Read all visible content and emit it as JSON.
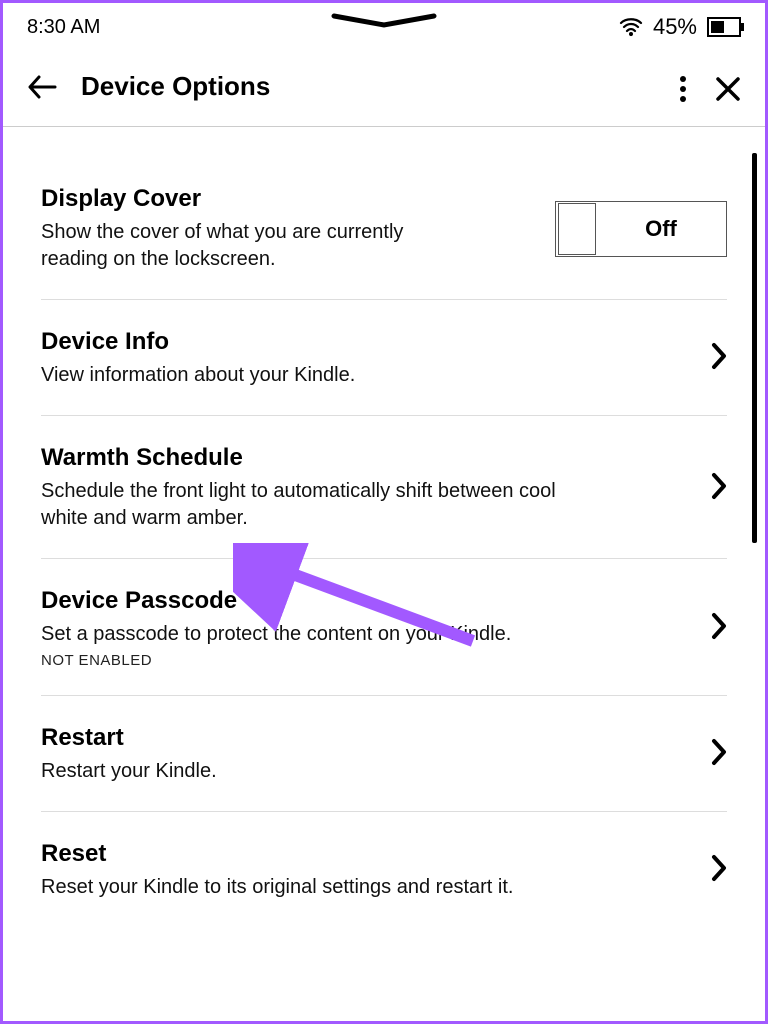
{
  "statusbar": {
    "time": "8:30 AM",
    "battery": "45%"
  },
  "header": {
    "title": "Device Options"
  },
  "items": [
    {
      "title": "Display Cover",
      "sub": "Show the cover of what you are currently reading on the lockscreen.",
      "toggle_state": "Off"
    },
    {
      "title": "Device Info",
      "sub": "View information about your Kindle."
    },
    {
      "title": "Warmth Schedule",
      "sub": "Schedule the front light to automatically shift between cool white and warm amber."
    },
    {
      "title": "Device Passcode",
      "sub": "Set a passcode to protect the content on your Kindle.",
      "status": "NOT ENABLED"
    },
    {
      "title": "Restart",
      "sub": "Restart your Kindle."
    },
    {
      "title": "Reset",
      "sub": "Reset your Kindle to its original settings and restart it."
    }
  ],
  "annotation": {
    "color": "#a259ff"
  }
}
